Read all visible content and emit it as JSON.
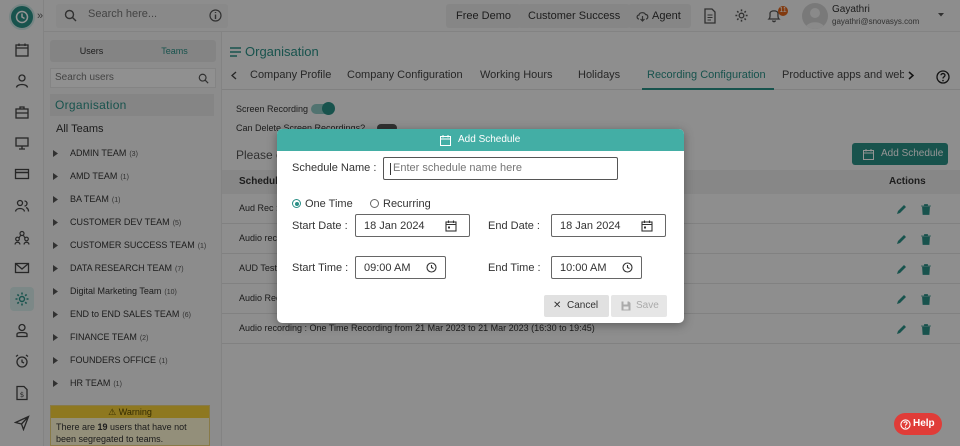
{
  "topbar": {
    "search_placeholder": "Search here...",
    "buttons": [
      "Free Demo",
      "Customer Success"
    ],
    "agent_label": "Agent",
    "notification_count": "11",
    "user_name": "Gayathri",
    "user_email": "gayathri@snovasys.com"
  },
  "team_panel": {
    "tabs": [
      "Users",
      "Teams"
    ],
    "search_placeholder": "Search users",
    "org_title": "Organisation",
    "all_teams": "All Teams",
    "teams": [
      {
        "name": "ADMIN TEAM",
        "count": "(3)"
      },
      {
        "name": "AMD TEAM",
        "count": "(1)"
      },
      {
        "name": "BA TEAM",
        "count": "(1)"
      },
      {
        "name": "CUSTOMER DEV TEAM",
        "count": "(5)"
      },
      {
        "name": "CUSTOMER SUCCESS TEAM",
        "count": "(1)"
      },
      {
        "name": "DATA RESEARCH TEAM",
        "count": "(7)"
      },
      {
        "name": "Digital Marketing Team",
        "count": "(10)"
      },
      {
        "name": "END to END SALES TEAM",
        "count": "(6)"
      },
      {
        "name": "FINANCE TEAM",
        "count": "(2)"
      },
      {
        "name": "FOUNDERS OFFICE",
        "count": "(1)"
      },
      {
        "name": "HR TEAM",
        "count": "(1)"
      }
    ],
    "warning_title": "Warning",
    "warning_pre": "There are ",
    "warning_count": "19",
    "warning_post": " users that have not been segregated to teams."
  },
  "main": {
    "title": "Organisation",
    "tabs": [
      "Company Profile",
      "Company Configuration",
      "Working Hours",
      "Holidays",
      "Recording Configuration",
      "Productive apps and web"
    ],
    "active_tab": "Recording Configuration",
    "screen_recording_label": "Screen Recording",
    "delete_label": "Can Delete Screen Recordings?",
    "please_text": "Please c",
    "add_schedule_label": "Add Schedule",
    "table_headers": {
      "schedule": "Schedule",
      "actions": "Actions"
    },
    "rows": [
      "Aud Rec : ",
      "Audio reco",
      "AUD Testi",
      "Audio Rec",
      "Audio recording : One Time Recording from 21 Mar 2023 to 21 Mar 2023 (16:30 to 19:45)"
    ]
  },
  "modal": {
    "title": "Add Schedule",
    "schedule_name_label": "Schedule Name :",
    "schedule_name_placeholder": "Enter schedule name here",
    "options": [
      "One Time",
      "Recurring"
    ],
    "selected_option": "One Time",
    "start_date_label": "Start Date :",
    "start_date": "18 Jan 2024",
    "end_date_label": "End Date :",
    "end_date": "18 Jan 2024",
    "start_time_label": "Start Time :",
    "start_time": "09:00 AM",
    "end_time_label": "End Time :",
    "end_time": "10:00 AM",
    "cancel_label": "Cancel",
    "save_label": "Save"
  },
  "help_label": "Help",
  "colors": {
    "accent": "#2a8f86",
    "modal_header": "#43aea5",
    "help": "#e03c38",
    "warning": "#f4cf38"
  }
}
